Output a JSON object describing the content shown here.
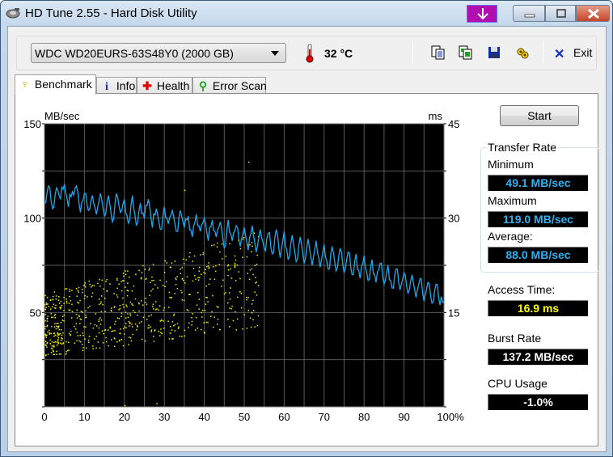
{
  "window": {
    "title": "HD Tune 2.55 - Hard Disk Utility",
    "controls": [
      "minimize",
      "maximize",
      "close"
    ]
  },
  "toolbar": {
    "drive": "WDC WD20EURS-63S48Y0 (2000 GB)",
    "temperature": "32 °C",
    "icons": [
      "copy-text-icon",
      "copy-screenshot-icon",
      "save-icon",
      "options-icon"
    ],
    "exit_label": "Exit"
  },
  "tabs": [
    {
      "label": "Benchmark",
      "icon": "bulb-icon",
      "active": true
    },
    {
      "label": "Info",
      "icon": "info-icon",
      "active": false
    },
    {
      "label": "Health",
      "icon": "health-cross-icon",
      "active": false
    },
    {
      "label": "Error Scan",
      "icon": "magnifier-icon",
      "active": false
    }
  ],
  "benchmark": {
    "start_label": "Start",
    "transfer_rate": {
      "title": "Transfer Rate",
      "minimum_label": "Minimum",
      "minimum": "49.1 MB/sec",
      "maximum_label": "Maximum",
      "maximum": "119.0 MB/sec",
      "average_label": "Average:",
      "average": "88.0 MB/sec"
    },
    "access_time_label": "Access Time:",
    "access_time": "16.9 ms",
    "burst_rate_label": "Burst Rate",
    "burst_rate": "137.2 MB/sec",
    "cpu_usage_label": "CPU Usage",
    "cpu_usage": "-1.0%",
    "colors": {
      "transfer": "#1fa8e8",
      "access": "#f0f000",
      "value_blue": "#30b0f0",
      "value_yellow": "#ffff00",
      "value_white": "#ffffff"
    }
  },
  "chart_data": {
    "type": "line",
    "title": "",
    "xlabel": "",
    "ylabel": "MB/sec",
    "y2label": "ms",
    "xlim": [
      0,
      100
    ],
    "ylim": [
      0,
      150
    ],
    "y2lim": [
      0,
      45
    ],
    "x_ticks": [
      "0",
      "10",
      "20",
      "30",
      "40",
      "50",
      "60",
      "70",
      "80",
      "90",
      "100%"
    ],
    "y_ticks": [
      "150",
      "100",
      "50"
    ],
    "y2_ticks": [
      "45",
      "30",
      "15"
    ],
    "grid": true,
    "series": [
      {
        "name": "Transfer rate (MB/sec)",
        "axis": "left",
        "x": [
          0,
          1,
          2,
          3,
          4,
          5,
          6,
          7,
          8,
          9,
          10,
          11,
          12,
          13,
          14,
          15,
          16,
          17,
          18,
          19,
          20,
          21,
          22,
          23,
          24,
          25,
          26,
          27,
          28,
          29,
          30,
          31,
          32,
          33,
          34,
          35,
          36,
          37,
          38,
          39,
          40,
          41,
          42,
          43,
          44,
          45,
          46,
          47,
          48,
          49,
          50,
          51,
          52,
          53,
          54,
          55,
          56,
          57,
          58,
          59,
          60,
          61,
          62,
          63,
          64,
          65,
          66,
          67,
          68,
          69,
          70,
          71,
          72,
          73,
          74,
          75,
          76,
          77,
          78,
          79,
          80,
          81,
          82,
          83,
          84,
          85,
          86,
          87,
          88,
          89,
          90,
          91,
          92,
          93,
          94,
          95,
          96,
          97,
          98,
          99,
          100
        ],
        "values": [
          108,
          117,
          105,
          116,
          110,
          118,
          106,
          114,
          117,
          103,
          113,
          104,
          112,
          102,
          113,
          101,
          112,
          98,
          113,
          103,
          110,
          97,
          112,
          96,
          108,
          100,
          110,
          95,
          105,
          94,
          106,
          97,
          104,
          93,
          104,
          95,
          101,
          90,
          102,
          93,
          100,
          88,
          99,
          90,
          98,
          84,
          99,
          88,
          96,
          85,
          95,
          83,
          96,
          82,
          94,
          84,
          92,
          81,
          94,
          79,
          93,
          78,
          91,
          77,
          90,
          76,
          89,
          75,
          88,
          74,
          86,
          73,
          85,
          72,
          84,
          71,
          82,
          70,
          81,
          68,
          80,
          67,
          78,
          66,
          76,
          65,
          75,
          63,
          73,
          62,
          71,
          60,
          70,
          58,
          68,
          56,
          66,
          55,
          65,
          54,
          56
        ]
      },
      {
        "name": "Access time (ms)",
        "axis": "right",
        "type": "scatter",
        "description": "yellow scatter cloud, mostly 8-22 ms between 0-50%, densest 12-20 ms"
      }
    ]
  }
}
